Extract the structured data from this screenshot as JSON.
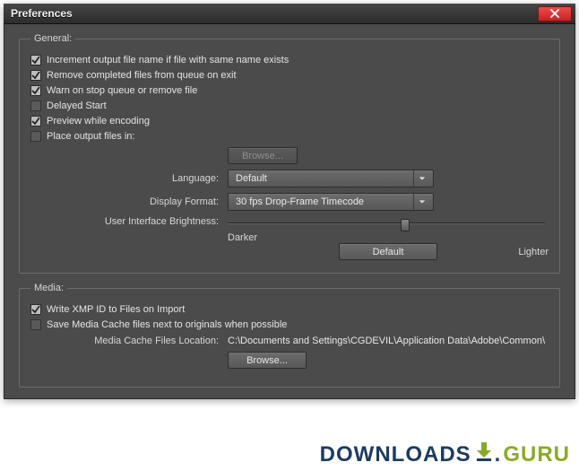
{
  "window": {
    "title": "Preferences"
  },
  "general": {
    "legend": "General:",
    "increment": {
      "label": "Increment output file name if file with same name exists",
      "checked": true
    },
    "remove_completed": {
      "label": "Remove completed files from queue on exit",
      "checked": true
    },
    "warn_stop": {
      "label": "Warn on stop queue or remove file",
      "checked": true
    },
    "delayed_start": {
      "label": "Delayed Start",
      "checked": false
    },
    "preview": {
      "label": "Preview while encoding",
      "checked": true
    },
    "place_output": {
      "label": "Place output files in:",
      "checked": false
    },
    "browse_disabled": "Browse...",
    "language_label": "Language:",
    "language_value": "Default",
    "display_format_label": "Display Format:",
    "display_format_value": "30 fps Drop-Frame Timecode",
    "brightness_label": "User Interface Brightness:",
    "darker": "Darker",
    "default_btn": "Default",
    "lighter": "Lighter",
    "slider_pct": 56
  },
  "media": {
    "legend": "Media:",
    "write_xmp": {
      "label": "Write XMP ID to Files on Import",
      "checked": true
    },
    "save_cache": {
      "label": "Save Media Cache files next to originals when possible",
      "checked": false
    },
    "cache_loc_label": "Media Cache Files Location:",
    "cache_loc_value": "C:\\Documents and Settings\\CGDEVIL\\Application Data\\Adobe\\Common\\",
    "browse": "Browse..."
  },
  "watermark": {
    "downloads": "DOWNLOADS",
    "guru": "GURU"
  }
}
